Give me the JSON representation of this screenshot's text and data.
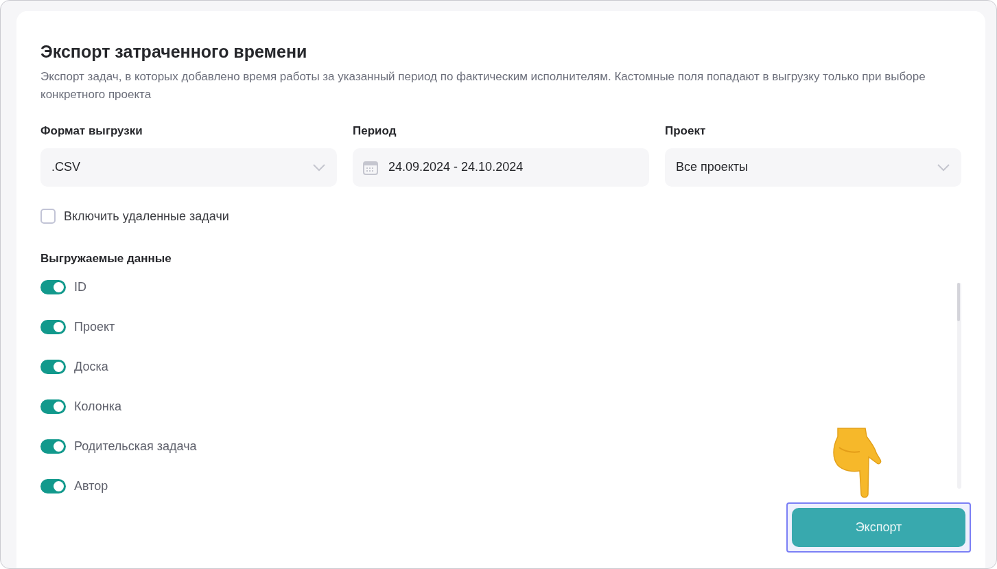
{
  "title": "Экспорт затраченного времени",
  "description": "Экспорт задач, в которых добавлено время работы за указанный период по фактическим исполнителям. Кастомные поля попадают в выгрузку только при выборе конкретного проекта",
  "fields": [
    {
      "kind": "select",
      "label": "Формат выгрузки",
      "value": ".CSV"
    },
    {
      "kind": "date",
      "label": "Период",
      "value": "24.09.2024 - 24.10.2024"
    },
    {
      "kind": "select",
      "label": "Проект",
      "value": "Все проекты"
    }
  ],
  "include_deleted": {
    "label": "Включить удаленные задачи",
    "checked": false
  },
  "data_section": {
    "title": "Выгружаемые данные",
    "items": [
      {
        "label": "ID",
        "on": true
      },
      {
        "label": "Проект",
        "on": true
      },
      {
        "label": "Доска",
        "on": true
      },
      {
        "label": "Колонка",
        "on": true
      },
      {
        "label": "Родительская задача",
        "on": true
      },
      {
        "label": "Автор",
        "on": true
      }
    ]
  },
  "export_button": {
    "label": "Экспорт",
    "focused": true
  }
}
